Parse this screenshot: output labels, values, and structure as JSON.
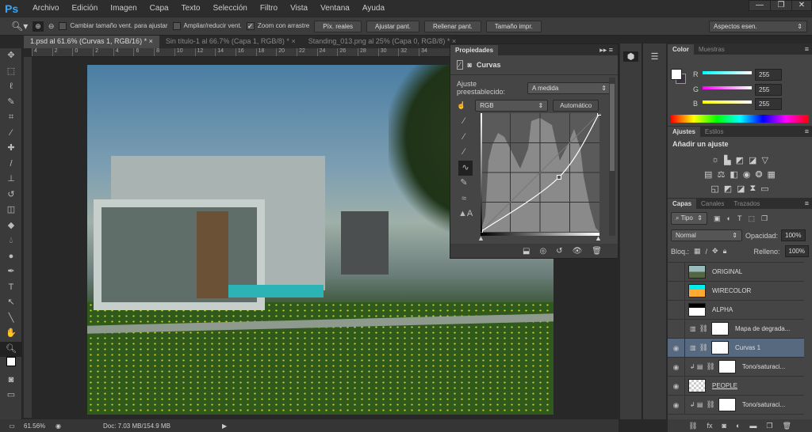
{
  "app": {
    "logo": "Ps"
  },
  "menu": [
    "Archivo",
    "Edición",
    "Imagen",
    "Capa",
    "Texto",
    "Selección",
    "Filtro",
    "Vista",
    "Ventana",
    "Ayuda"
  ],
  "window_controls": {
    "minimize": "—",
    "restore": "❐",
    "close": "✕"
  },
  "options": {
    "resize_windows": "Cambiar tamaño vent. para ajustar",
    "zoom_all": "Ampliar/reducir vent.",
    "scrubby_zoom": "Zoom con arrastre",
    "actual_pixels": "Píx. reales",
    "fit_screen": "Ajustar pant.",
    "fill_screen": "Rellenar pant.",
    "print_size": "Tamaño impr.",
    "workspace": "Aspectos esen."
  },
  "tabs": [
    {
      "label": "1.psd al 61.6% (Curvas 1, RGB/16) *",
      "close": "×"
    },
    {
      "label": "Sin título-1 al 66.7% (Capa 1, RGB/8) *",
      "close": "×"
    },
    {
      "label": "Standing_013.png al 25% (Capa 0, RGB/8) *",
      "close": "×"
    }
  ],
  "ruler_top": [
    "4",
    "2",
    "0",
    "2",
    "4",
    "6",
    "8",
    "10",
    "12",
    "14",
    "16",
    "18",
    "20",
    "22",
    "24",
    "26",
    "28",
    "30",
    "32",
    "34"
  ],
  "status": {
    "zoom": "61.56%",
    "doc": "Doc: 7.03 MB/154.9 MB"
  },
  "properties": {
    "tab": "Propiedades",
    "title": "Curvas",
    "preset_label": "Ajuste preestablecido:",
    "preset_value": "A medida",
    "channel": "RGB",
    "auto": "Automático",
    "curve_points": [
      [
        0,
        0
      ],
      [
        0.66,
        0.46
      ],
      [
        1,
        1
      ]
    ]
  },
  "color": {
    "tab": "Color",
    "tab2": "Muestras",
    "r_label": "R",
    "g_label": "G",
    "b_label": "B",
    "r": "255",
    "g": "255",
    "b": "255"
  },
  "adjustments": {
    "tab": "Ajustes",
    "tab2": "Estilos",
    "heading": "Añadir un ajuste"
  },
  "layers": {
    "tab": "Capas",
    "tab2": "Canales",
    "tab3": "Trazados",
    "filter": "Tipo",
    "blend": "Normal",
    "opacity_label": "Opacidad:",
    "opacity": "100%",
    "lock_label": "Bloq.:",
    "fill_label": "Relleno:",
    "fill": "100%",
    "items": [
      {
        "name": "ORIGINAL",
        "visible": false
      },
      {
        "name": "WIRECOLOR",
        "visible": false
      },
      {
        "name": "ALPHA",
        "visible": false
      },
      {
        "name": "Mapa de degrada...",
        "visible": false
      },
      {
        "name": "Curvas 1",
        "visible": true
      },
      {
        "name": "Tono/saturaci...",
        "visible": true
      },
      {
        "name": "PEOPLE",
        "visible": true
      },
      {
        "name": "Tono/saturaci...",
        "visible": true
      }
    ]
  }
}
